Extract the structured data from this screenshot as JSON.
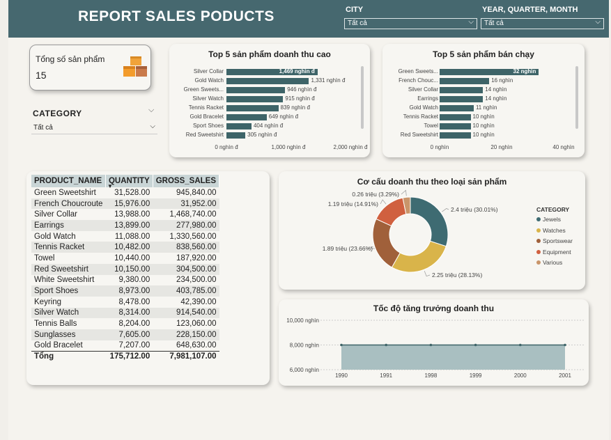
{
  "header": {
    "title": "REPORT SALES PODUCTS"
  },
  "filters": {
    "city": {
      "label": "CITY",
      "value": "Tất cả"
    },
    "period": {
      "label": "YEAR, QUARTER, MONTH",
      "value": "Tất cả"
    },
    "category": {
      "label": "CATEGORY",
      "value": "Tất cả"
    }
  },
  "kpi": {
    "label": "Tổng số sản phẩm",
    "value": "15",
    "icon": "boxes-icon"
  },
  "colors": {
    "header": "#46686f",
    "bar": "#3e6468",
    "jewels": "#3e6b72",
    "watches": "#d9b44a",
    "sportswear": "#a0603a",
    "equipment": "#d0603f",
    "various": "#c9956a"
  },
  "top_revenue": {
    "title": "Top 5 sản phẩm doanh thu cao",
    "chart_data": {
      "type": "bar",
      "categories": [
        "Silver Collar",
        "Gold Watch",
        "Green Sweets...",
        "Silver Watch",
        "Tennis Racket",
        "Gold Bracelet",
        "Sport Shoes",
        "Red Sweetshirt"
      ],
      "values": [
        1469,
        1331,
        946,
        915,
        839,
        649,
        404,
        305
      ],
      "value_labels": [
        "1,469 nghìn đ",
        "1,331 nghìn đ",
        "946 nghìn đ",
        "915 nghìn đ",
        "839 nghìn đ",
        "649 nghìn đ",
        "404 nghìn đ",
        "305 nghìn đ"
      ],
      "xlim": [
        0,
        2000
      ],
      "ticks": [
        "0 nghìn đ",
        "1,000 nghìn đ",
        "2,000 nghìn đ"
      ]
    }
  },
  "top_selling": {
    "title": "Top 5 sản phẩm bán chạy",
    "chart_data": {
      "type": "bar",
      "categories": [
        "Green Sweets...",
        "French Chouc...",
        "Silver Collar",
        "Earrings",
        "Gold Watch",
        "Tennis Racket",
        "Towel",
        "Red Sweetshirt"
      ],
      "values": [
        32,
        16,
        14,
        14,
        11,
        10,
        10,
        10
      ],
      "value_labels": [
        "32 nghìn",
        "16 nghìn",
        "14 nghìn",
        "14 nghìn",
        "11 nghìn",
        "10 nghìn",
        "10 nghìn",
        "10 nghìn"
      ],
      "xlim": [
        0,
        40
      ],
      "ticks": [
        "0 nghìn",
        "20 nghìn",
        "40 nghìn"
      ]
    }
  },
  "table": {
    "headers": [
      "PRODUCT_NAME",
      "QUANTITY",
      "GROSS_SALES"
    ],
    "rows": [
      [
        "Green Sweetshirt",
        "31,528.00",
        "945,840.00"
      ],
      [
        "French Choucroute",
        "15,976.00",
        "31,952.00"
      ],
      [
        "Silver Collar",
        "13,988.00",
        "1,468,740.00"
      ],
      [
        "Earrings",
        "13,899.00",
        "277,980.00"
      ],
      [
        "Gold Watch",
        "11,088.00",
        "1,330,560.00"
      ],
      [
        "Tennis Racket",
        "10,482.00",
        "838,560.00"
      ],
      [
        "Towel",
        "10,440.00",
        "187,920.00"
      ],
      [
        "Red Sweetshirt",
        "10,150.00",
        "304,500.00"
      ],
      [
        "White Sweetshirt",
        "9,380.00",
        "234,500.00"
      ],
      [
        "Sport Shoes",
        "8,973.00",
        "403,785.00"
      ],
      [
        "Keyring",
        "8,478.00",
        "42,390.00"
      ],
      [
        "Silver Watch",
        "8,314.00",
        "914,540.00"
      ],
      [
        "Tennis Balls",
        "8,204.00",
        "123,060.00"
      ],
      [
        "Sunglasses",
        "7,605.00",
        "228,150.00"
      ],
      [
        "Gold Bracelet",
        "7,207.00",
        "648,630.00"
      ]
    ],
    "total": [
      "Tổng",
      "175,712.00",
      "7,981,107.00"
    ]
  },
  "donut": {
    "title": "Cơ cấu doanh thu theo loại sản phẩm",
    "legend_title": "CATEGORY",
    "chart_data": {
      "type": "pie",
      "categories": [
        "Jewels",
        "Watches",
        "Sportswear",
        "Equipment",
        "Various"
      ],
      "values": [
        2.4,
        2.25,
        1.89,
        1.19,
        0.26
      ],
      "percents": [
        30.01,
        28.13,
        23.66,
        14.91,
        3.29
      ],
      "labels": [
        "2.4 triệu (30.01%)",
        "2.25 triệu (28.13%)",
        "1.89 triệu (23.66%)",
        "1.19 triệu (14.91%)",
        "0.26 triệu (3.29%)"
      ]
    }
  },
  "growth": {
    "title": "Tốc độ tăng trưởng doanh thu",
    "chart_data": {
      "type": "area",
      "x": [
        "1990",
        "1991",
        "1998",
        "1999",
        "2000",
        "2001"
      ],
      "values": [
        8000,
        8000,
        8000,
        8000,
        8000,
        8000
      ],
      "ylim": [
        6000,
        10000
      ],
      "yticks": [
        "10,000 nghìn",
        "8,000 nghìn",
        "6,000 nghìn"
      ]
    }
  }
}
